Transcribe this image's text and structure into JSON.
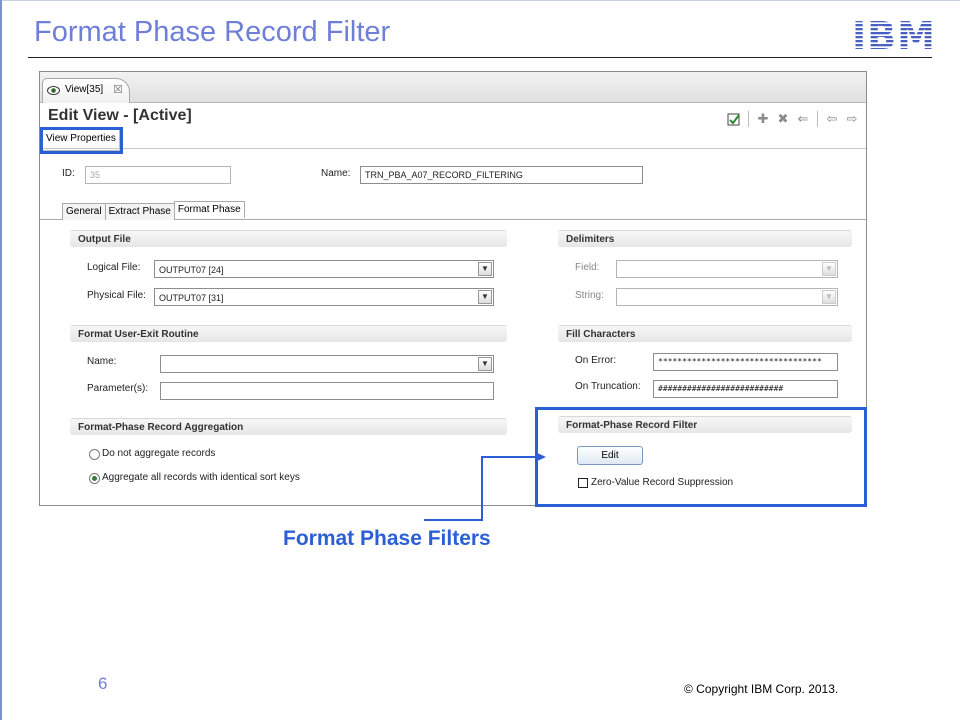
{
  "slide": {
    "title": "Format Phase Record Filter",
    "logo_text": "IBM",
    "page_number": "6",
    "copyright": "© Copyright  IBM Corp. 2013.",
    "callout_label": "Format Phase Filters",
    "accent_color": "#2c5fd6",
    "title_color": "#6f7fd8"
  },
  "window": {
    "tab_label": "View[35]",
    "tab_icon": "eye-icon",
    "close_glyph": "☒",
    "edit_title": "Edit View - [Active]",
    "toolbar_icons": [
      "save-icon",
      "add-icon",
      "delete-icon",
      "undo-icon",
      "back-icon",
      "forward-icon"
    ],
    "view_properties_tab": "View Properties"
  },
  "view_properties": {
    "id_label": "ID:",
    "id_value": "35",
    "name_label": "Name:",
    "name_value": "TRN_PBA_A07_RECORD_FILTERING"
  },
  "phase_tabs": [
    {
      "label": "General",
      "active": false
    },
    {
      "label": "Extract Phase",
      "active": false
    },
    {
      "label": "Format Phase",
      "active": true
    }
  ],
  "output_file": {
    "heading": "Output File",
    "logical_label": "Logical File:",
    "logical_value": "OUTPUT07 [24]",
    "physical_label": "Physical File:",
    "physical_value": "OUTPUT07 [31]"
  },
  "delimiters": {
    "heading": "Delimiters",
    "field_label": "Field:",
    "field_value": "",
    "string_label": "String:",
    "string_value": ""
  },
  "user_exit": {
    "heading": "Format User-Exit Routine",
    "name_label": "Name:",
    "name_value": "",
    "params_label": "Parameter(s):",
    "params_value": ""
  },
  "fill_chars": {
    "heading": "Fill Characters",
    "on_error_label": "On Error:",
    "on_error_value": "**********************************",
    "on_truncation_label": "On Truncation:",
    "on_truncation_value": "##########################"
  },
  "aggregation": {
    "heading": "Format-Phase Record Aggregation",
    "option_none": "Do not aggregate records",
    "option_all": "Aggregate all records with identical sort keys",
    "selected": "option_all"
  },
  "record_filter": {
    "heading": "Format-Phase Record Filter",
    "edit_button": "Edit",
    "zero_value_label": "Zero-Value Record Suppression",
    "zero_value_checked": false
  }
}
